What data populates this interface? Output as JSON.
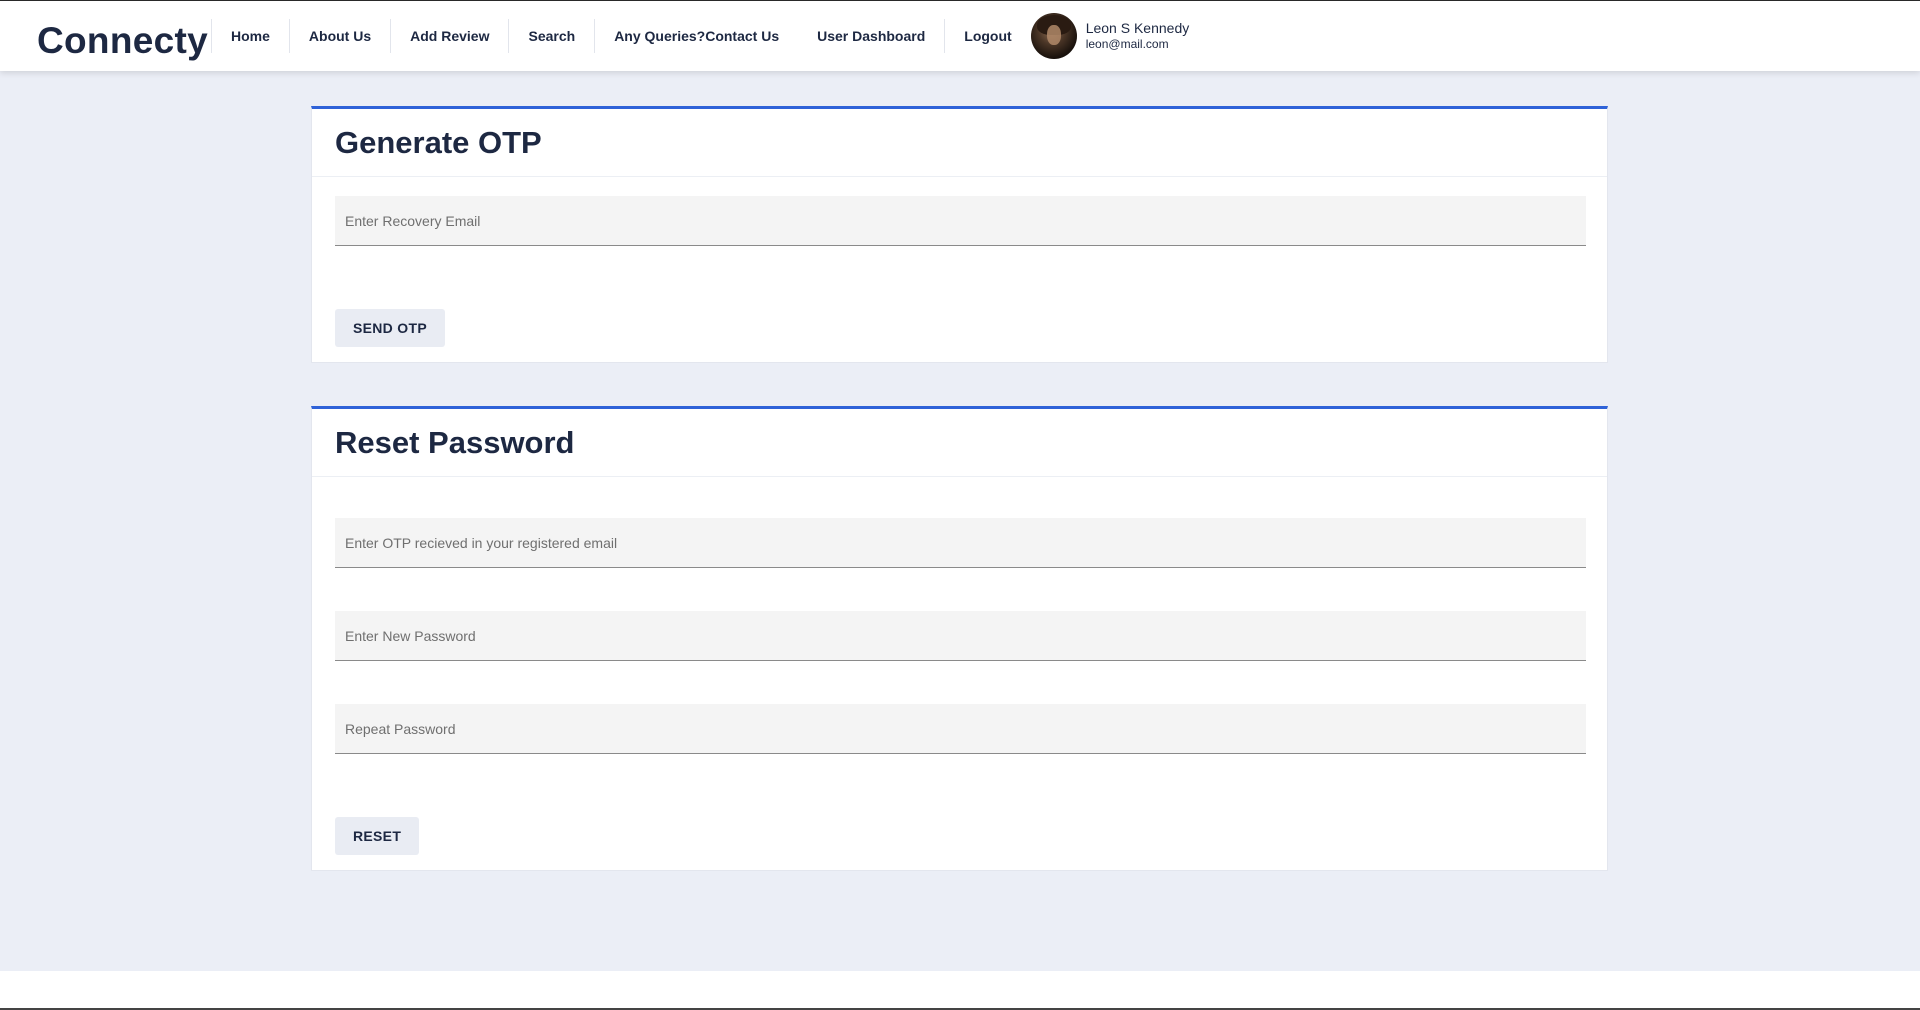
{
  "brand": "Connecty",
  "nav": {
    "items": [
      {
        "label": "Home"
      },
      {
        "label": "About Us"
      },
      {
        "label": "Add Review"
      },
      {
        "label": "Search"
      },
      {
        "label": "Any Queries?Contact Us"
      },
      {
        "label": "User Dashboard"
      },
      {
        "label": "Logout"
      }
    ]
  },
  "user": {
    "name": "Leon S Kennedy",
    "email": "leon@mail.com"
  },
  "generate_otp": {
    "title": "Generate OTP",
    "email_placeholder": "Enter Recovery Email",
    "button_label": "SEND OTP"
  },
  "reset_password": {
    "title": "Reset Password",
    "otp_placeholder": "Enter OTP recieved in your registered email",
    "new_password_placeholder": "Enter New Password",
    "repeat_password_placeholder": "Repeat Password",
    "button_label": "RESET"
  },
  "colors": {
    "accent": "#2f62d8",
    "background": "#ebeef6",
    "text": "#1d2842"
  }
}
